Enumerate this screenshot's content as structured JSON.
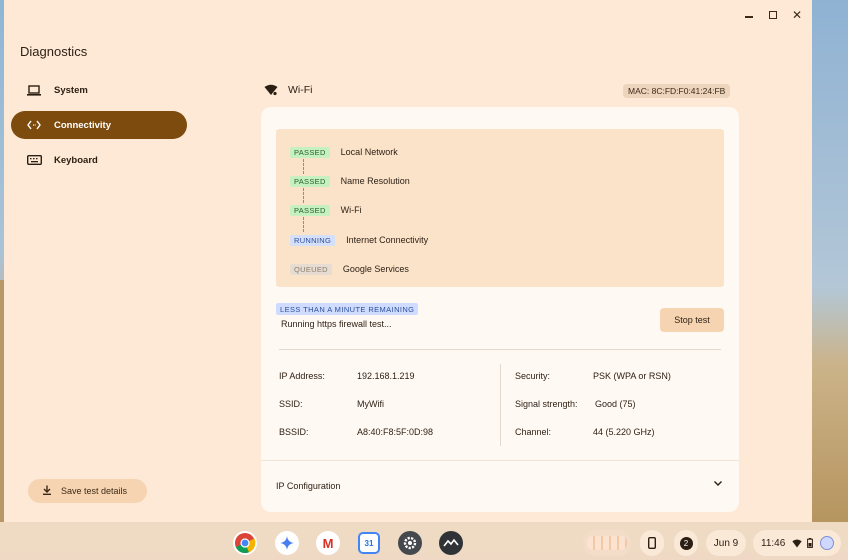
{
  "app": {
    "title": "Diagnostics"
  },
  "window_controls": {
    "close": "✕"
  },
  "sidebar": {
    "items": [
      {
        "label": "System",
        "icon": "laptop-icon",
        "active": false
      },
      {
        "label": "Connectivity",
        "icon": "code-brackets-icon",
        "active": true
      },
      {
        "label": "Keyboard",
        "icon": "keyboard-icon",
        "active": false
      }
    ],
    "save_button": "Save test details"
  },
  "network": {
    "name": "Wi-Fi",
    "mac": "MAC: 8C:FD:F0:41:24:FB"
  },
  "routines": [
    {
      "status": "PASSED",
      "name": "Local Network"
    },
    {
      "status": "PASSED",
      "name": "Name Resolution"
    },
    {
      "status": "PASSED",
      "name": "Wi-Fi"
    },
    {
      "status": "RUNNING",
      "name": "Internet Connectivity"
    },
    {
      "status": "QUEUED",
      "name": "Google Services"
    }
  ],
  "progress": {
    "badge": "LESS THAN A MINUTE REMAINING",
    "text": "Running https firewall test...",
    "stop_button": "Stop test"
  },
  "info": {
    "ip_label": "IP Address:",
    "ip_value": "192.168.1.219",
    "ssid_label": "SSID:",
    "ssid_value": "MyWifi",
    "bssid_label": "BSSID:",
    "bssid_value": "A8:40:F8:5F:0D:98",
    "security_label": "Security:",
    "security_value": "PSK (WPA or RSN)",
    "signal_label": "Signal strength:",
    "signal_value": "Good (75)",
    "channel_label": "Channel:",
    "channel_value": "44 (5.220 GHz)"
  },
  "ip_config": {
    "label": "IP Configuration"
  },
  "shelf": {
    "notification_count": "2",
    "date": "Jun 9",
    "time": "11:46",
    "gmail_letter": "M",
    "calendar_day": "31"
  },
  "colors": {
    "window_bg": "#fde9d5",
    "accent": "#7d4b0e",
    "passed": "#c6f0c0",
    "running": "#d4dffa",
    "queued": "#e7dcd1"
  }
}
